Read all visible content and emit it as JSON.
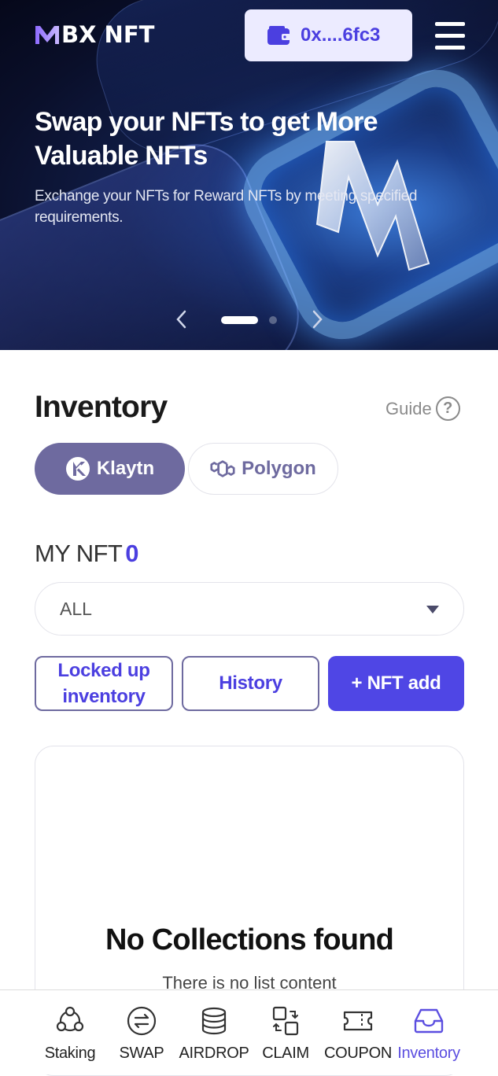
{
  "header": {
    "logo_text": "BX NFT",
    "wallet_address": "0x....6fc3"
  },
  "hero": {
    "title": "Swap your NFTs to get More Valuable NFTs",
    "subtitle": " Exchange your NFTs for Reward NFTs by meeting specified requirements.",
    "slide_count": 2,
    "active_slide": 1
  },
  "inventory": {
    "title": "Inventory",
    "guide_label": "Guide",
    "chains": [
      {
        "label": "Klaytn",
        "active": true
      },
      {
        "label": "Polygon",
        "active": false
      }
    ],
    "my_nft_label": "MY NFT",
    "my_nft_count": "0",
    "filter_value": "ALL",
    "buttons": {
      "locked": "Locked up inventory",
      "history": "History",
      "add": "+ NFT add"
    },
    "empty_title": "No Collections found",
    "empty_subtitle": "There is no list content"
  },
  "bottom_nav": {
    "items": [
      {
        "label": "Staking",
        "icon": "staking-icon"
      },
      {
        "label": "SWAP",
        "icon": "swap-icon"
      },
      {
        "label": "AIRDROP",
        "icon": "airdrop-icon"
      },
      {
        "label": "CLAIM",
        "icon": "claim-icon"
      },
      {
        "label": "COUPON",
        "icon": "coupon-icon"
      },
      {
        "label": "Inventory",
        "icon": "inventory-icon"
      }
    ],
    "active_item": "Inventory"
  },
  "colors": {
    "accent": "#4f46e5",
    "chain_active": "#6e6a9f",
    "wallet_bg": "#ecebff",
    "nav_active": "#5b4ee0"
  }
}
